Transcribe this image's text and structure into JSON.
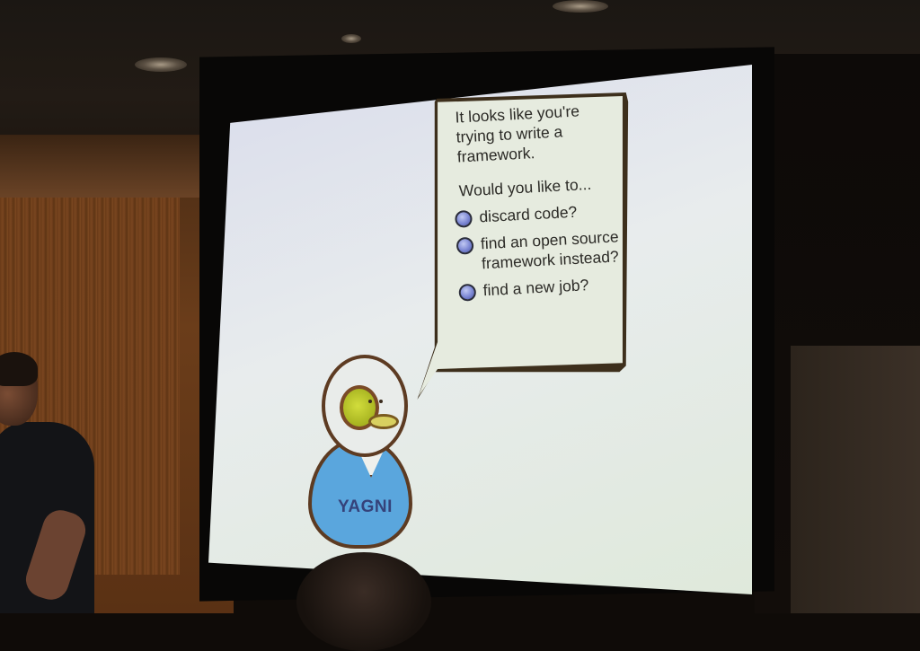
{
  "slide": {
    "bubble_intro": "It looks like you're trying to write a framework.",
    "bubble_question": "Would you like to...",
    "options": [
      "discard code?",
      "find an open source framework instead?",
      "find a new job?"
    ],
    "character_label": "YAGNI"
  },
  "colors": {
    "screen": "#e3e7e6",
    "bubble": "#e6ebdf",
    "character_shirt": "#5aa6dd",
    "eyepatch": "#c9d43a",
    "radio": "#7b86d3"
  }
}
